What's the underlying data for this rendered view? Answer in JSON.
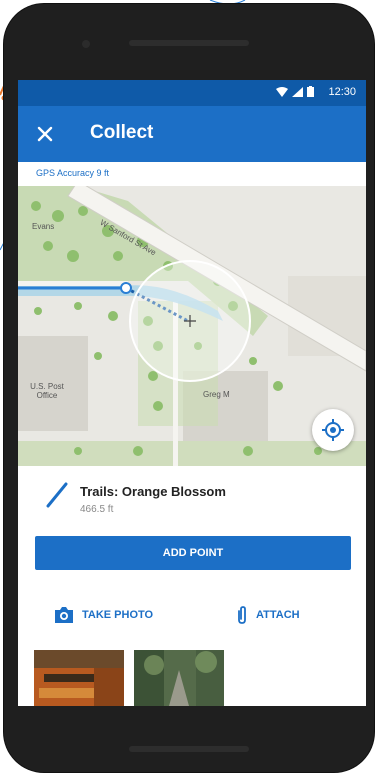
{
  "status_bar": {
    "time": "12:30",
    "wifi_icon": "wifi-icon",
    "signal_icon": "signal-icon",
    "battery_icon": "battery-icon"
  },
  "app_bar": {
    "title": "Collect",
    "close_icon": "close-icon"
  },
  "gps": {
    "accuracy_text": "GPS Accuracy 9 ft"
  },
  "map": {
    "street_label": "W Sanford St Ave",
    "labels": [
      "U.S. Post Office",
      "Greg M",
      "Evans"
    ],
    "locate_icon": "crosshair-icon"
  },
  "feature": {
    "title": "Trails: Orange Blossom",
    "length": "466.5 ft",
    "icon": "line-icon"
  },
  "buttons": {
    "add_point": "ADD POINT",
    "take_photo": "TAKE PHOTO",
    "attach": "ATTACH"
  },
  "colors": {
    "primary": "#1c6fc6",
    "status_bar": "#0f5aa8",
    "map_bg": "#e9e8e3",
    "path": "#2a7fd4"
  }
}
